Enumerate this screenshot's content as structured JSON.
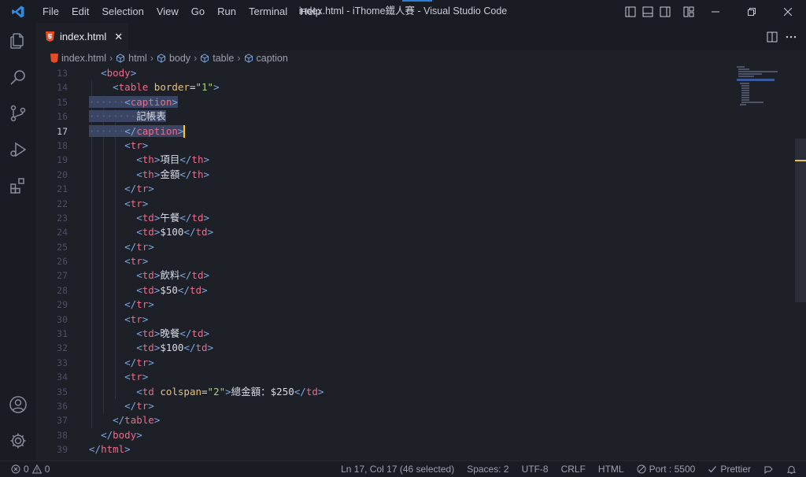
{
  "menu": [
    "File",
    "Edit",
    "Selection",
    "View",
    "Go",
    "Run",
    "Terminal",
    "Help"
  ],
  "window_title": "index.html - iThome鐵人賽 - Visual Studio Code",
  "tab": {
    "label": "index.html",
    "close": "✕"
  },
  "breadcrumb": [
    "index.html",
    "html",
    "body",
    "table",
    "caption"
  ],
  "editor": {
    "line_numbers": [
      "13",
      "14",
      "15",
      "16",
      "17",
      "18",
      "19",
      "20",
      "21",
      "22",
      "23",
      "24",
      "25",
      "26",
      "27",
      "28",
      "29",
      "30",
      "31",
      "32",
      "33",
      "34",
      "35",
      "36",
      "37",
      "38",
      "39"
    ],
    "active_line": "17"
  },
  "code_text": {
    "c_caption": "記帳表",
    "th1": "項目",
    "th2": "金額",
    "td1": "午餐",
    "td2": "$100",
    "td3": "飲料",
    "td4": "$50",
    "td5": "晚餐",
    "td6": "$100",
    "td_total": "總金額：$250",
    "border_attr": "border",
    "border_val": "\"1\"",
    "colspan_attr": "colspan",
    "colspan_val": "\"2\""
  },
  "status": {
    "errors": "0",
    "warnings": "0",
    "position": "Ln 17, Col 17 (46 selected)",
    "spaces": "Spaces: 2",
    "encoding": "UTF-8",
    "eol": "CRLF",
    "language": "HTML",
    "port": "Port : 5500",
    "prettier": "Prettier"
  },
  "colors": {
    "background": "#1e2028",
    "chrome": "#1a1c23",
    "tag": "#e86c8a",
    "bracket": "#7ea8e0",
    "attribute": "#e6c07b",
    "string": "#a8d17f",
    "selection": "#3a4563"
  }
}
